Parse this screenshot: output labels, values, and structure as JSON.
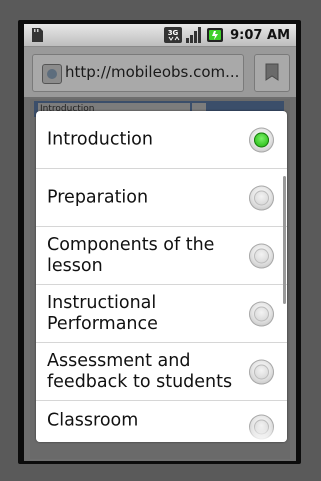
{
  "status_bar": {
    "network": "3G",
    "time": "9:07 AM"
  },
  "browser": {
    "url": "http://mobileobs.com..."
  },
  "page": {
    "nav_label": "Introduction"
  },
  "dialog": {
    "items": [
      {
        "label": "Introduction",
        "checked": true
      },
      {
        "label": "Preparation",
        "checked": false
      },
      {
        "label": "Components of the lesson",
        "checked": false
      },
      {
        "label": "Instructional Performance",
        "checked": false
      },
      {
        "label": "Assessment and feedback to students",
        "checked": false
      },
      {
        "label": "Classroom",
        "checked": false
      }
    ]
  },
  "colors": {
    "radio_checked": "#2fc21d",
    "dialog_background": "#ffffff"
  }
}
